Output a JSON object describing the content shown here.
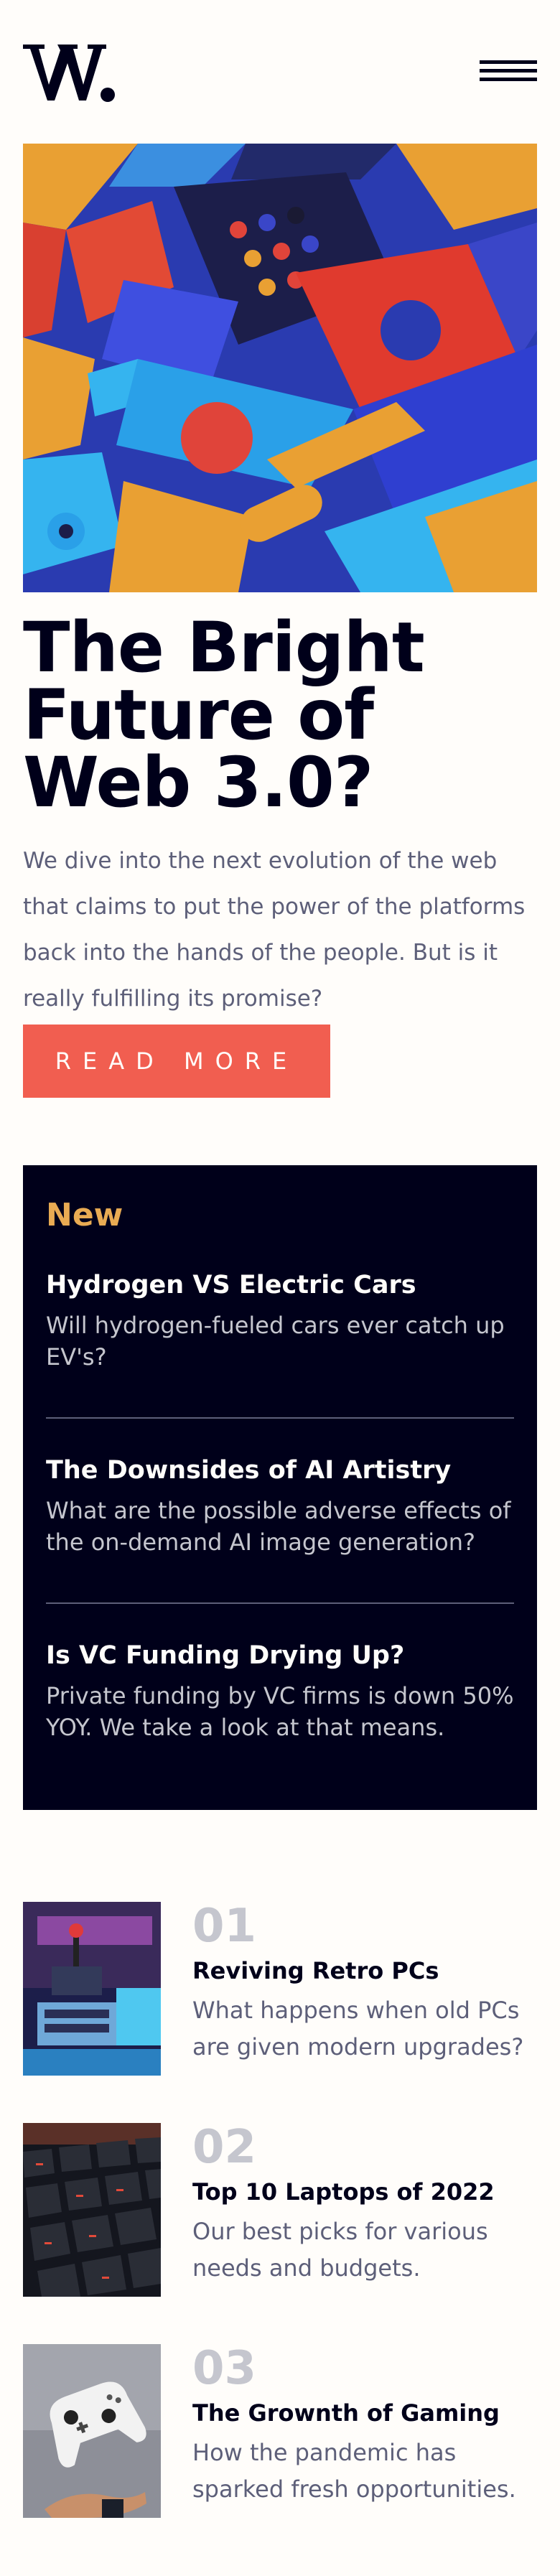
{
  "brand": {
    "logo_text": "W."
  },
  "header": {
    "menu_icon": "hamburger-menu-icon"
  },
  "hero": {
    "title": "The Bright Future of Web 3.0?",
    "description": "We dive into the next evolution of the web that claims to put the power of the platforms back into the hands of the people. But is it really fulfilling its promise?",
    "cta_label": "READ MORE"
  },
  "new": {
    "heading": "New",
    "items": [
      {
        "title": "Hydrogen VS Electric Cars",
        "desc": "Will hydrogen-fueled cars ever catch up EV's?"
      },
      {
        "title": "The Downsides of AI Artistry",
        "desc": "What are the possible adverse effects of the on-demand AI image generation?"
      },
      {
        "title": "Is VC Funding Drying Up?",
        "desc": "Private funding by VC firms is down 50% YOY. We take a look at that means."
      }
    ]
  },
  "articles": [
    {
      "number": "01",
      "title": "Reviving Retro PCs",
      "desc": "What happens when old PCs are given modern upgrades?"
    },
    {
      "number": "02",
      "title": "Top 10 Laptops of 2022",
      "desc": "Our best picks for various needs and budgets."
    },
    {
      "number": "03",
      "title": "The Grownth of Gaming",
      "desc": "How the pandemic has sparked fresh opportunities."
    }
  ],
  "colors": {
    "accent": "#f15e50",
    "dark": "#00001a",
    "gold": "#e9ab53",
    "gray": "#5d5f79",
    "light_gray": "#c5c6ce",
    "background": "#fffdfa"
  }
}
